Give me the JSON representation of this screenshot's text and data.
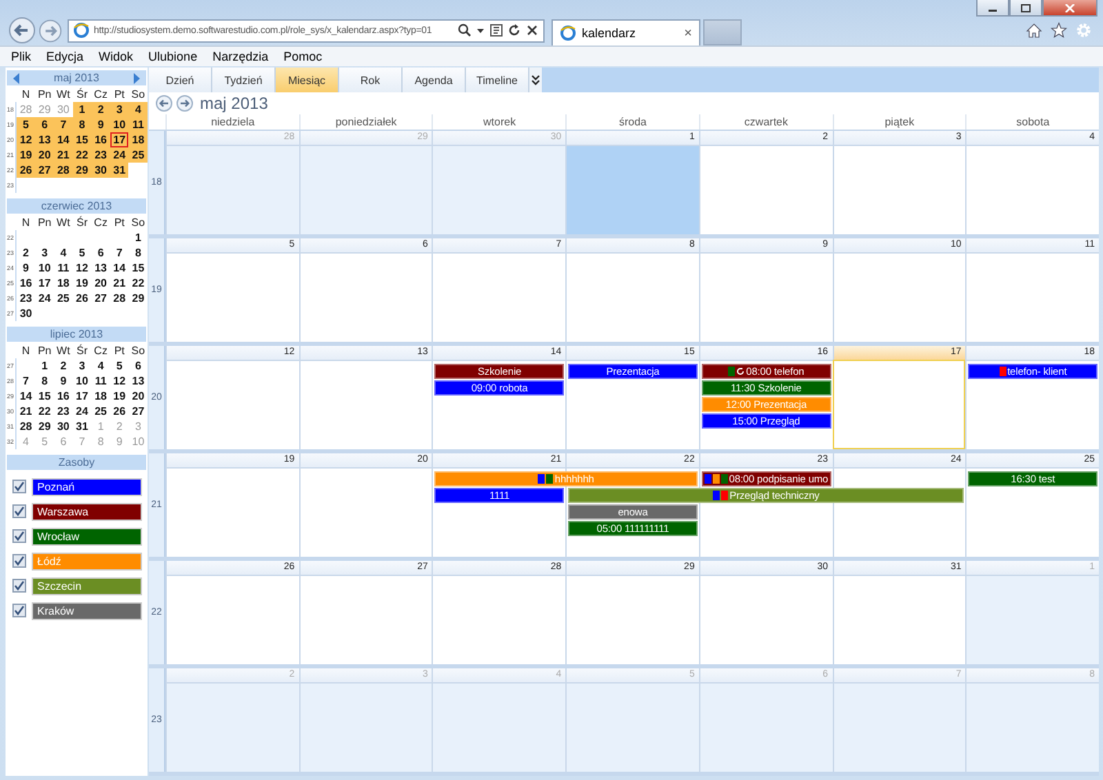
{
  "browser": {
    "address": "http://studiosystem.demo.softwarestudio.com.pl/role_sys/x_kalendarz.aspx?typ=01",
    "tab": "kalendarz",
    "tab_close": "×"
  },
  "menu": [
    "Plik",
    "Edycja",
    "Widok",
    "Ulubione",
    "Narzędzia",
    "Pomoc"
  ],
  "mini_calendars": [
    {
      "title": "maj 2013",
      "has_nav": true,
      "weekdays": [
        "N",
        "Pn",
        "Wt",
        "Śr",
        "Cz",
        "Pt",
        "So"
      ],
      "weeks": [
        {
          "no": "18",
          "days": [
            {
              "kind": "day",
              "n": "28",
              "muted": true,
              "in_view": false,
              "today": false
            },
            {
              "kind": "day",
              "n": "29",
              "muted": true,
              "in_view": false,
              "today": false
            },
            {
              "kind": "day",
              "n": "30",
              "muted": true,
              "in_view": false,
              "today": false
            },
            {
              "kind": "day",
              "n": "1",
              "muted": false,
              "in_view": true,
              "today": false
            },
            {
              "kind": "day",
              "n": "2",
              "muted": false,
              "in_view": true,
              "today": false
            },
            {
              "kind": "day",
              "n": "3",
              "muted": false,
              "in_view": true,
              "today": false
            },
            {
              "kind": "day",
              "n": "4",
              "muted": false,
              "in_view": true,
              "today": false
            }
          ]
        },
        {
          "no": "19",
          "days": [
            {
              "kind": "day",
              "n": "5",
              "muted": false,
              "in_view": true,
              "today": false
            },
            {
              "kind": "day",
              "n": "6",
              "muted": false,
              "in_view": true,
              "today": false
            },
            {
              "kind": "day",
              "n": "7",
              "muted": false,
              "in_view": true,
              "today": false
            },
            {
              "kind": "day",
              "n": "8",
              "muted": false,
              "in_view": true,
              "today": false
            },
            {
              "kind": "day",
              "n": "9",
              "muted": false,
              "in_view": true,
              "today": false
            },
            {
              "kind": "day",
              "n": "10",
              "muted": false,
              "in_view": true,
              "today": false
            },
            {
              "kind": "day",
              "n": "11",
              "muted": false,
              "in_view": true,
              "today": false
            }
          ]
        },
        {
          "no": "20",
          "days": [
            {
              "kind": "day",
              "n": "12",
              "muted": false,
              "in_view": true,
              "today": false
            },
            {
              "kind": "day",
              "n": "13",
              "muted": false,
              "in_view": true,
              "today": false
            },
            {
              "kind": "day",
              "n": "14",
              "muted": false,
              "in_view": true,
              "today": false
            },
            {
              "kind": "day",
              "n": "15",
              "muted": false,
              "in_view": true,
              "today": false
            },
            {
              "kind": "day",
              "n": "16",
              "muted": false,
              "in_view": true,
              "today": false
            },
            {
              "kind": "day",
              "n": "17",
              "muted": false,
              "in_view": true,
              "today": true
            },
            {
              "kind": "day",
              "n": "18",
              "muted": false,
              "in_view": true,
              "today": false
            }
          ]
        },
        {
          "no": "21",
          "days": [
            {
              "kind": "day",
              "n": "19",
              "muted": false,
              "in_view": true,
              "today": false
            },
            {
              "kind": "day",
              "n": "20",
              "muted": false,
              "in_view": true,
              "today": false
            },
            {
              "kind": "day",
              "n": "21",
              "muted": false,
              "in_view": true,
              "today": false
            },
            {
              "kind": "day",
              "n": "22",
              "muted": false,
              "in_view": true,
              "today": false
            },
            {
              "kind": "day",
              "n": "23",
              "muted": false,
              "in_view": true,
              "today": false
            },
            {
              "kind": "day",
              "n": "24",
              "muted": false,
              "in_view": true,
              "today": false
            },
            {
              "kind": "day",
              "n": "25",
              "muted": false,
              "in_view": true,
              "today": false
            }
          ]
        },
        {
          "no": "22",
          "days": [
            {
              "kind": "day",
              "n": "26",
              "muted": false,
              "in_view": true,
              "today": false
            },
            {
              "kind": "day",
              "n": "27",
              "muted": false,
              "in_view": true,
              "today": false
            },
            {
              "kind": "day",
              "n": "28",
              "muted": false,
              "in_view": true,
              "today": false
            },
            {
              "kind": "day",
              "n": "29",
              "muted": false,
              "in_view": true,
              "today": false
            },
            {
              "kind": "day",
              "n": "30",
              "muted": false,
              "in_view": true,
              "today": false
            },
            {
              "kind": "day",
              "n": "31",
              "muted": false,
              "in_view": true,
              "today": false
            },
            {
              "kind": "blank"
            }
          ]
        },
        {
          "no": "23",
          "days": [
            {
              "kind": "blank"
            },
            {
              "kind": "blank"
            },
            {
              "kind": "blank"
            },
            {
              "kind": "blank"
            },
            {
              "kind": "blank"
            },
            {
              "kind": "blank"
            },
            {
              "kind": "blank"
            }
          ]
        }
      ]
    },
    {
      "title": "czerwiec 2013",
      "has_nav": false,
      "weekdays": [
        "N",
        "Pn",
        "Wt",
        "Śr",
        "Cz",
        "Pt",
        "So"
      ],
      "weeks": [
        {
          "no": "22",
          "days": [
            {
              "kind": "blank"
            },
            {
              "kind": "blank"
            },
            {
              "kind": "blank"
            },
            {
              "kind": "blank"
            },
            {
              "kind": "blank"
            },
            {
              "kind": "blank"
            },
            {
              "kind": "day",
              "n": "1",
              "muted": false,
              "in_view": false,
              "today": false
            }
          ]
        },
        {
          "no": "23",
          "days": [
            {
              "kind": "day",
              "n": "2",
              "muted": false,
              "in_view": false,
              "today": false
            },
            {
              "kind": "day",
              "n": "3",
              "muted": false,
              "in_view": false,
              "today": false
            },
            {
              "kind": "day",
              "n": "4",
              "muted": false,
              "in_view": false,
              "today": false
            },
            {
              "kind": "day",
              "n": "5",
              "muted": false,
              "in_view": false,
              "today": false
            },
            {
              "kind": "day",
              "n": "6",
              "muted": false,
              "in_view": false,
              "today": false
            },
            {
              "kind": "day",
              "n": "7",
              "muted": false,
              "in_view": false,
              "today": false
            },
            {
              "kind": "day",
              "n": "8",
              "muted": false,
              "in_view": false,
              "today": false
            }
          ]
        },
        {
          "no": "24",
          "days": [
            {
              "kind": "day",
              "n": "9",
              "muted": false,
              "in_view": false,
              "today": false
            },
            {
              "kind": "day",
              "n": "10",
              "muted": false,
              "in_view": false,
              "today": false
            },
            {
              "kind": "day",
              "n": "11",
              "muted": false,
              "in_view": false,
              "today": false
            },
            {
              "kind": "day",
              "n": "12",
              "muted": false,
              "in_view": false,
              "today": false
            },
            {
              "kind": "day",
              "n": "13",
              "muted": false,
              "in_view": false,
              "today": false
            },
            {
              "kind": "day",
              "n": "14",
              "muted": false,
              "in_view": false,
              "today": false
            },
            {
              "kind": "day",
              "n": "15",
              "muted": false,
              "in_view": false,
              "today": false
            }
          ]
        },
        {
          "no": "25",
          "days": [
            {
              "kind": "day",
              "n": "16",
              "muted": false,
              "in_view": false,
              "today": false
            },
            {
              "kind": "day",
              "n": "17",
              "muted": false,
              "in_view": false,
              "today": false
            },
            {
              "kind": "day",
              "n": "18",
              "muted": false,
              "in_view": false,
              "today": false
            },
            {
              "kind": "day",
              "n": "19",
              "muted": false,
              "in_view": false,
              "today": false
            },
            {
              "kind": "day",
              "n": "20",
              "muted": false,
              "in_view": false,
              "today": false
            },
            {
              "kind": "day",
              "n": "21",
              "muted": false,
              "in_view": false,
              "today": false
            },
            {
              "kind": "day",
              "n": "22",
              "muted": false,
              "in_view": false,
              "today": false
            }
          ]
        },
        {
          "no": "26",
          "days": [
            {
              "kind": "day",
              "n": "23",
              "muted": false,
              "in_view": false,
              "today": false
            },
            {
              "kind": "day",
              "n": "24",
              "muted": false,
              "in_view": false,
              "today": false
            },
            {
              "kind": "day",
              "n": "25",
              "muted": false,
              "in_view": false,
              "today": false
            },
            {
              "kind": "day",
              "n": "26",
              "muted": false,
              "in_view": false,
              "today": false
            },
            {
              "kind": "day",
              "n": "27",
              "muted": false,
              "in_view": false,
              "today": false
            },
            {
              "kind": "day",
              "n": "28",
              "muted": false,
              "in_view": false,
              "today": false
            },
            {
              "kind": "day",
              "n": "29",
              "muted": false,
              "in_view": false,
              "today": false
            }
          ]
        },
        {
          "no": "27",
          "days": [
            {
              "kind": "day",
              "n": "30",
              "muted": false,
              "in_view": false,
              "today": false
            },
            {
              "kind": "blank"
            },
            {
              "kind": "blank"
            },
            {
              "kind": "blank"
            },
            {
              "kind": "blank"
            },
            {
              "kind": "blank"
            },
            {
              "kind": "blank"
            }
          ]
        }
      ]
    },
    {
      "title": "lipiec 2013",
      "has_nav": false,
      "weekdays": [
        "N",
        "Pn",
        "Wt",
        "Śr",
        "Cz",
        "Pt",
        "So"
      ],
      "weeks": [
        {
          "no": "27",
          "days": [
            {
              "kind": "blank"
            },
            {
              "kind": "day",
              "n": "1",
              "muted": false,
              "in_view": false,
              "today": false
            },
            {
              "kind": "day",
              "n": "2",
              "muted": false,
              "in_view": false,
              "today": false
            },
            {
              "kind": "day",
              "n": "3",
              "muted": false,
              "in_view": false,
              "today": false
            },
            {
              "kind": "day",
              "n": "4",
              "muted": false,
              "in_view": false,
              "today": false
            },
            {
              "kind": "day",
              "n": "5",
              "muted": false,
              "in_view": false,
              "today": false
            },
            {
              "kind": "day",
              "n": "6",
              "muted": false,
              "in_view": false,
              "today": false
            }
          ]
        },
        {
          "no": "28",
          "days": [
            {
              "kind": "day",
              "n": "7",
              "muted": false,
              "in_view": false,
              "today": false
            },
            {
              "kind": "day",
              "n": "8",
              "muted": false,
              "in_view": false,
              "today": false
            },
            {
              "kind": "day",
              "n": "9",
              "muted": false,
              "in_view": false,
              "today": false
            },
            {
              "kind": "day",
              "n": "10",
              "muted": false,
              "in_view": false,
              "today": false
            },
            {
              "kind": "day",
              "n": "11",
              "muted": false,
              "in_view": false,
              "today": false
            },
            {
              "kind": "day",
              "n": "12",
              "muted": false,
              "in_view": false,
              "today": false
            },
            {
              "kind": "day",
              "n": "13",
              "muted": false,
              "in_view": false,
              "today": false
            }
          ]
        },
        {
          "no": "29",
          "days": [
            {
              "kind": "day",
              "n": "14",
              "muted": false,
              "in_view": false,
              "today": false
            },
            {
              "kind": "day",
              "n": "15",
              "muted": false,
              "in_view": false,
              "today": false
            },
            {
              "kind": "day",
              "n": "16",
              "muted": false,
              "in_view": false,
              "today": false
            },
            {
              "kind": "day",
              "n": "17",
              "muted": false,
              "in_view": false,
              "today": false
            },
            {
              "kind": "day",
              "n": "18",
              "muted": false,
              "in_view": false,
              "today": false
            },
            {
              "kind": "day",
              "n": "19",
              "muted": false,
              "in_view": false,
              "today": false
            },
            {
              "kind": "day",
              "n": "20",
              "muted": false,
              "in_view": false,
              "today": false
            }
          ]
        },
        {
          "no": "30",
          "days": [
            {
              "kind": "day",
              "n": "21",
              "muted": false,
              "in_view": false,
              "today": false
            },
            {
              "kind": "day",
              "n": "22",
              "muted": false,
              "in_view": false,
              "today": false
            },
            {
              "kind": "day",
              "n": "23",
              "muted": false,
              "in_view": false,
              "today": false
            },
            {
              "kind": "day",
              "n": "24",
              "muted": false,
              "in_view": false,
              "today": false
            },
            {
              "kind": "day",
              "n": "25",
              "muted": false,
              "in_view": false,
              "today": false
            },
            {
              "kind": "day",
              "n": "26",
              "muted": false,
              "in_view": false,
              "today": false
            },
            {
              "kind": "day",
              "n": "27",
              "muted": false,
              "in_view": false,
              "today": false
            }
          ]
        },
        {
          "no": "31",
          "days": [
            {
              "kind": "day",
              "n": "28",
              "muted": false,
              "in_view": false,
              "today": false
            },
            {
              "kind": "day",
              "n": "29",
              "muted": false,
              "in_view": false,
              "today": false
            },
            {
              "kind": "day",
              "n": "30",
              "muted": false,
              "in_view": false,
              "today": false
            },
            {
              "kind": "day",
              "n": "31",
              "muted": false,
              "in_view": false,
              "today": false
            },
            {
              "kind": "day",
              "n": "1",
              "muted": true,
              "in_view": false,
              "today": false
            },
            {
              "kind": "day",
              "n": "2",
              "muted": true,
              "in_view": false,
              "today": false
            },
            {
              "kind": "day",
              "n": "3",
              "muted": true,
              "in_view": false,
              "today": false
            }
          ]
        },
        {
          "no": "32",
          "days": [
            {
              "kind": "day",
              "n": "4",
              "muted": true,
              "in_view": false,
              "today": false
            },
            {
              "kind": "day",
              "n": "5",
              "muted": true,
              "in_view": false,
              "today": false
            },
            {
              "kind": "day",
              "n": "6",
              "muted": true,
              "in_view": false,
              "today": false
            },
            {
              "kind": "day",
              "n": "7",
              "muted": true,
              "in_view": false,
              "today": false
            },
            {
              "kind": "day",
              "n": "8",
              "muted": true,
              "in_view": false,
              "today": false
            },
            {
              "kind": "day",
              "n": "9",
              "muted": true,
              "in_view": false,
              "today": false
            },
            {
              "kind": "day",
              "n": "10",
              "muted": true,
              "in_view": false,
              "today": false
            }
          ]
        }
      ]
    }
  ],
  "resources": {
    "title": "Zasoby",
    "items": [
      {
        "name": "Poznań",
        "checked": true,
        "color": "#0000ff"
      },
      {
        "name": "Warszawa",
        "checked": true,
        "color": "#800000"
      },
      {
        "name": "Wrocław",
        "checked": true,
        "color": "#006400"
      },
      {
        "name": "Łódź",
        "checked": true,
        "color": "#ff8c00"
      },
      {
        "name": "Szczecin",
        "checked": true,
        "color": "#6b8e23"
      },
      {
        "name": "Kraków",
        "checked": true,
        "color": "#696969"
      }
    ]
  },
  "views": [
    {
      "label": "Dzień",
      "selected": false
    },
    {
      "label": "Tydzień",
      "selected": false
    },
    {
      "label": "Miesiąc",
      "selected": true
    },
    {
      "label": "Rok",
      "selected": false
    },
    {
      "label": "Agenda",
      "selected": false
    },
    {
      "label": "Timeline",
      "selected": false
    }
  ],
  "title": "maj 2013",
  "weekdays": [
    "niedziela",
    "poniedziałek",
    "wtorek",
    "środa",
    "czwartek",
    "piątek",
    "sobota"
  ],
  "weeks": [
    {
      "no": "18",
      "days": [
        {
          "n": "28",
          "other_month": true,
          "selected": false,
          "today": false
        },
        {
          "n": "29",
          "other_month": true,
          "selected": false,
          "today": false
        },
        {
          "n": "30",
          "other_month": true,
          "selected": false,
          "today": false
        },
        {
          "n": "1",
          "other_month": false,
          "selected": true,
          "today": false
        },
        {
          "n": "2",
          "other_month": false,
          "selected": false,
          "today": false
        },
        {
          "n": "3",
          "other_month": false,
          "selected": false,
          "today": false
        },
        {
          "n": "4",
          "other_month": false,
          "selected": false,
          "today": false
        }
      ]
    },
    {
      "no": "19",
      "days": [
        {
          "n": "5",
          "other_month": false,
          "selected": false,
          "today": false
        },
        {
          "n": "6",
          "other_month": false,
          "selected": false,
          "today": false
        },
        {
          "n": "7",
          "other_month": false,
          "selected": false,
          "today": false
        },
        {
          "n": "8",
          "other_month": false,
          "selected": false,
          "today": false
        },
        {
          "n": "9",
          "other_month": false,
          "selected": false,
          "today": false
        },
        {
          "n": "10",
          "other_month": false,
          "selected": false,
          "today": false
        },
        {
          "n": "11",
          "other_month": false,
          "selected": false,
          "today": false
        }
      ]
    },
    {
      "no": "20",
      "days": [
        {
          "n": "12",
          "other_month": false,
          "selected": false,
          "today": false
        },
        {
          "n": "13",
          "other_month": false,
          "selected": false,
          "today": false
        },
        {
          "n": "14",
          "other_month": false,
          "selected": false,
          "today": false,
          "events": [
            {
              "text": "Szkolenie",
              "color": "#800000",
              "recurring": false
            },
            {
              "text": "09:00 robota",
              "color": "#0000ff",
              "recurring": false
            }
          ]
        },
        {
          "n": "15",
          "other_month": false,
          "selected": false,
          "today": false,
          "events": [
            {
              "text": "Prezentacja",
              "color": "#0000ff",
              "recurring": false
            }
          ]
        },
        {
          "n": "16",
          "other_month": false,
          "selected": false,
          "today": false,
          "events": [
            {
              "text": "08:00 telefon",
              "color": "#800000",
              "markers": [
                {
                  "color": "#006400"
                }
              ],
              "recurring": true
            },
            {
              "text": "11:30 Szkolenie",
              "color": "#006400",
              "recurring": false
            },
            {
              "text": "12:00 Prezentacja",
              "color": "#ff8c00",
              "recurring": false
            },
            {
              "text": "15:00 Przegląd",
              "color": "#0000ff",
              "recurring": false
            }
          ]
        },
        {
          "n": "17",
          "other_month": false,
          "selected": false,
          "today": true
        },
        {
          "n": "18",
          "other_month": false,
          "selected": false,
          "today": false,
          "events": [
            {
              "text": "telefon- klient",
              "color": "#0000ff",
              "markers": [
                {
                  "color": "#ff0000"
                }
              ],
              "recurring": false
            }
          ]
        }
      ]
    },
    {
      "no": "21",
      "days": [
        {
          "n": "19",
          "other_month": false,
          "selected": false,
          "today": false
        },
        {
          "n": "20",
          "other_month": false,
          "selected": false,
          "today": false
        },
        {
          "n": "21",
          "other_month": false,
          "selected": false,
          "today": false,
          "events": [
            {
              "text": "hhhhhhh",
              "color": "#ff8c00",
              "markers": [
                {
                  "color": "#0000ff"
                },
                {
                  "color": "#006400"
                }
              ],
              "recurring": false,
              "extends_into_next_days": [
                true
              ]
            },
            {
              "text": "1111",
              "color": "#0000ff",
              "recurring": false
            }
          ]
        },
        {
          "n": "22",
          "other_month": false,
          "selected": false,
          "today": false,
          "events": [
            {
              "text": "Przegląd techniczny",
              "color": "#6b8e23",
              "markers": [
                {
                  "color": "#0000ff"
                },
                {
                  "color": "#ff0000"
                }
              ],
              "recurring": false,
              "extends_into_next_days": [
                true,
                true
              ]
            },
            {
              "text": "enowa",
              "color": "#696969",
              "recurring": false
            },
            {
              "text": "05:00 111111111",
              "color": "#006400",
              "recurring": false
            }
          ]
        },
        {
          "n": "23",
          "other_month": false,
          "selected": false,
          "today": false,
          "events": [
            {
              "text": "08:00 podpisanie umo",
              "color": "#800000",
              "markers": [
                {
                  "color": "#0000ff"
                },
                {
                  "color": "#ff8c00"
                },
                {
                  "color": "#006400"
                }
              ],
              "recurring": false
            }
          ]
        },
        {
          "n": "24",
          "other_month": false,
          "selected": false,
          "today": false
        },
        {
          "n": "25",
          "other_month": false,
          "selected": false,
          "today": false,
          "events": [
            {
              "text": "16:30 test",
              "color": "#006400",
              "recurring": false
            }
          ]
        }
      ]
    },
    {
      "no": "22",
      "days": [
        {
          "n": "26",
          "other_month": false,
          "selected": false,
          "today": false
        },
        {
          "n": "27",
          "other_month": false,
          "selected": false,
          "today": false
        },
        {
          "n": "28",
          "other_month": false,
          "selected": false,
          "today": false
        },
        {
          "n": "29",
          "other_month": false,
          "selected": false,
          "today": false
        },
        {
          "n": "30",
          "other_month": false,
          "selected": false,
          "today": false
        },
        {
          "n": "31",
          "other_month": false,
          "selected": false,
          "today": false
        },
        {
          "n": "1",
          "other_month": true,
          "selected": false,
          "today": false
        }
      ]
    },
    {
      "no": "23",
      "days": [
        {
          "n": "2",
          "other_month": true,
          "selected": false,
          "today": false
        },
        {
          "n": "3",
          "other_month": true,
          "selected": false,
          "today": false
        },
        {
          "n": "4",
          "other_month": true,
          "selected": false,
          "today": false
        },
        {
          "n": "5",
          "other_month": true,
          "selected": false,
          "today": false
        },
        {
          "n": "6",
          "other_month": true,
          "selected": false,
          "today": false
        },
        {
          "n": "7",
          "other_month": true,
          "selected": false,
          "today": false
        },
        {
          "n": "8",
          "other_month": true,
          "selected": false,
          "today": false
        }
      ]
    }
  ]
}
